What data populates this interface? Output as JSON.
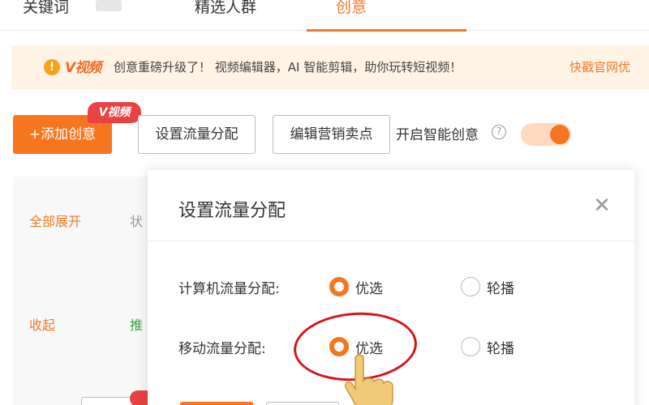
{
  "tabs": {
    "items": [
      {
        "label": "关键词"
      },
      {
        "label": "精选人群"
      },
      {
        "label": "创意"
      }
    ],
    "active_index": 2
  },
  "notice": {
    "logo": "V视频",
    "text": "创意重磅升级了！ 视频编辑器，AI 智能剪辑，助你玩转短视频！",
    "link": "快戳官网优"
  },
  "toolbar": {
    "add_label": "+添加创意",
    "badge": "V视频",
    "traffic_label": "设置流量分配",
    "selling_label": "编辑营销卖点",
    "smart_label": "开启智能创意",
    "smart_enabled": true
  },
  "background": {
    "expand_all": "全部展开",
    "status_cut": "状",
    "collapse": "收起",
    "promote_cut": "推"
  },
  "modal": {
    "title": "设置流量分配",
    "rows": [
      {
        "label": "计算机流量分配:",
        "options": [
          {
            "label": "优选",
            "checked": true
          },
          {
            "label": "轮播",
            "checked": false
          }
        ]
      },
      {
        "label": "移动流量分配:",
        "options": [
          {
            "label": "优选",
            "checked": true
          },
          {
            "label": "轮播",
            "checked": false
          }
        ]
      }
    ]
  },
  "colors": {
    "accent": "#f5761f",
    "annotation": "#d8141c",
    "badge": "#e94242",
    "notice_bg": "#fff3e6"
  }
}
